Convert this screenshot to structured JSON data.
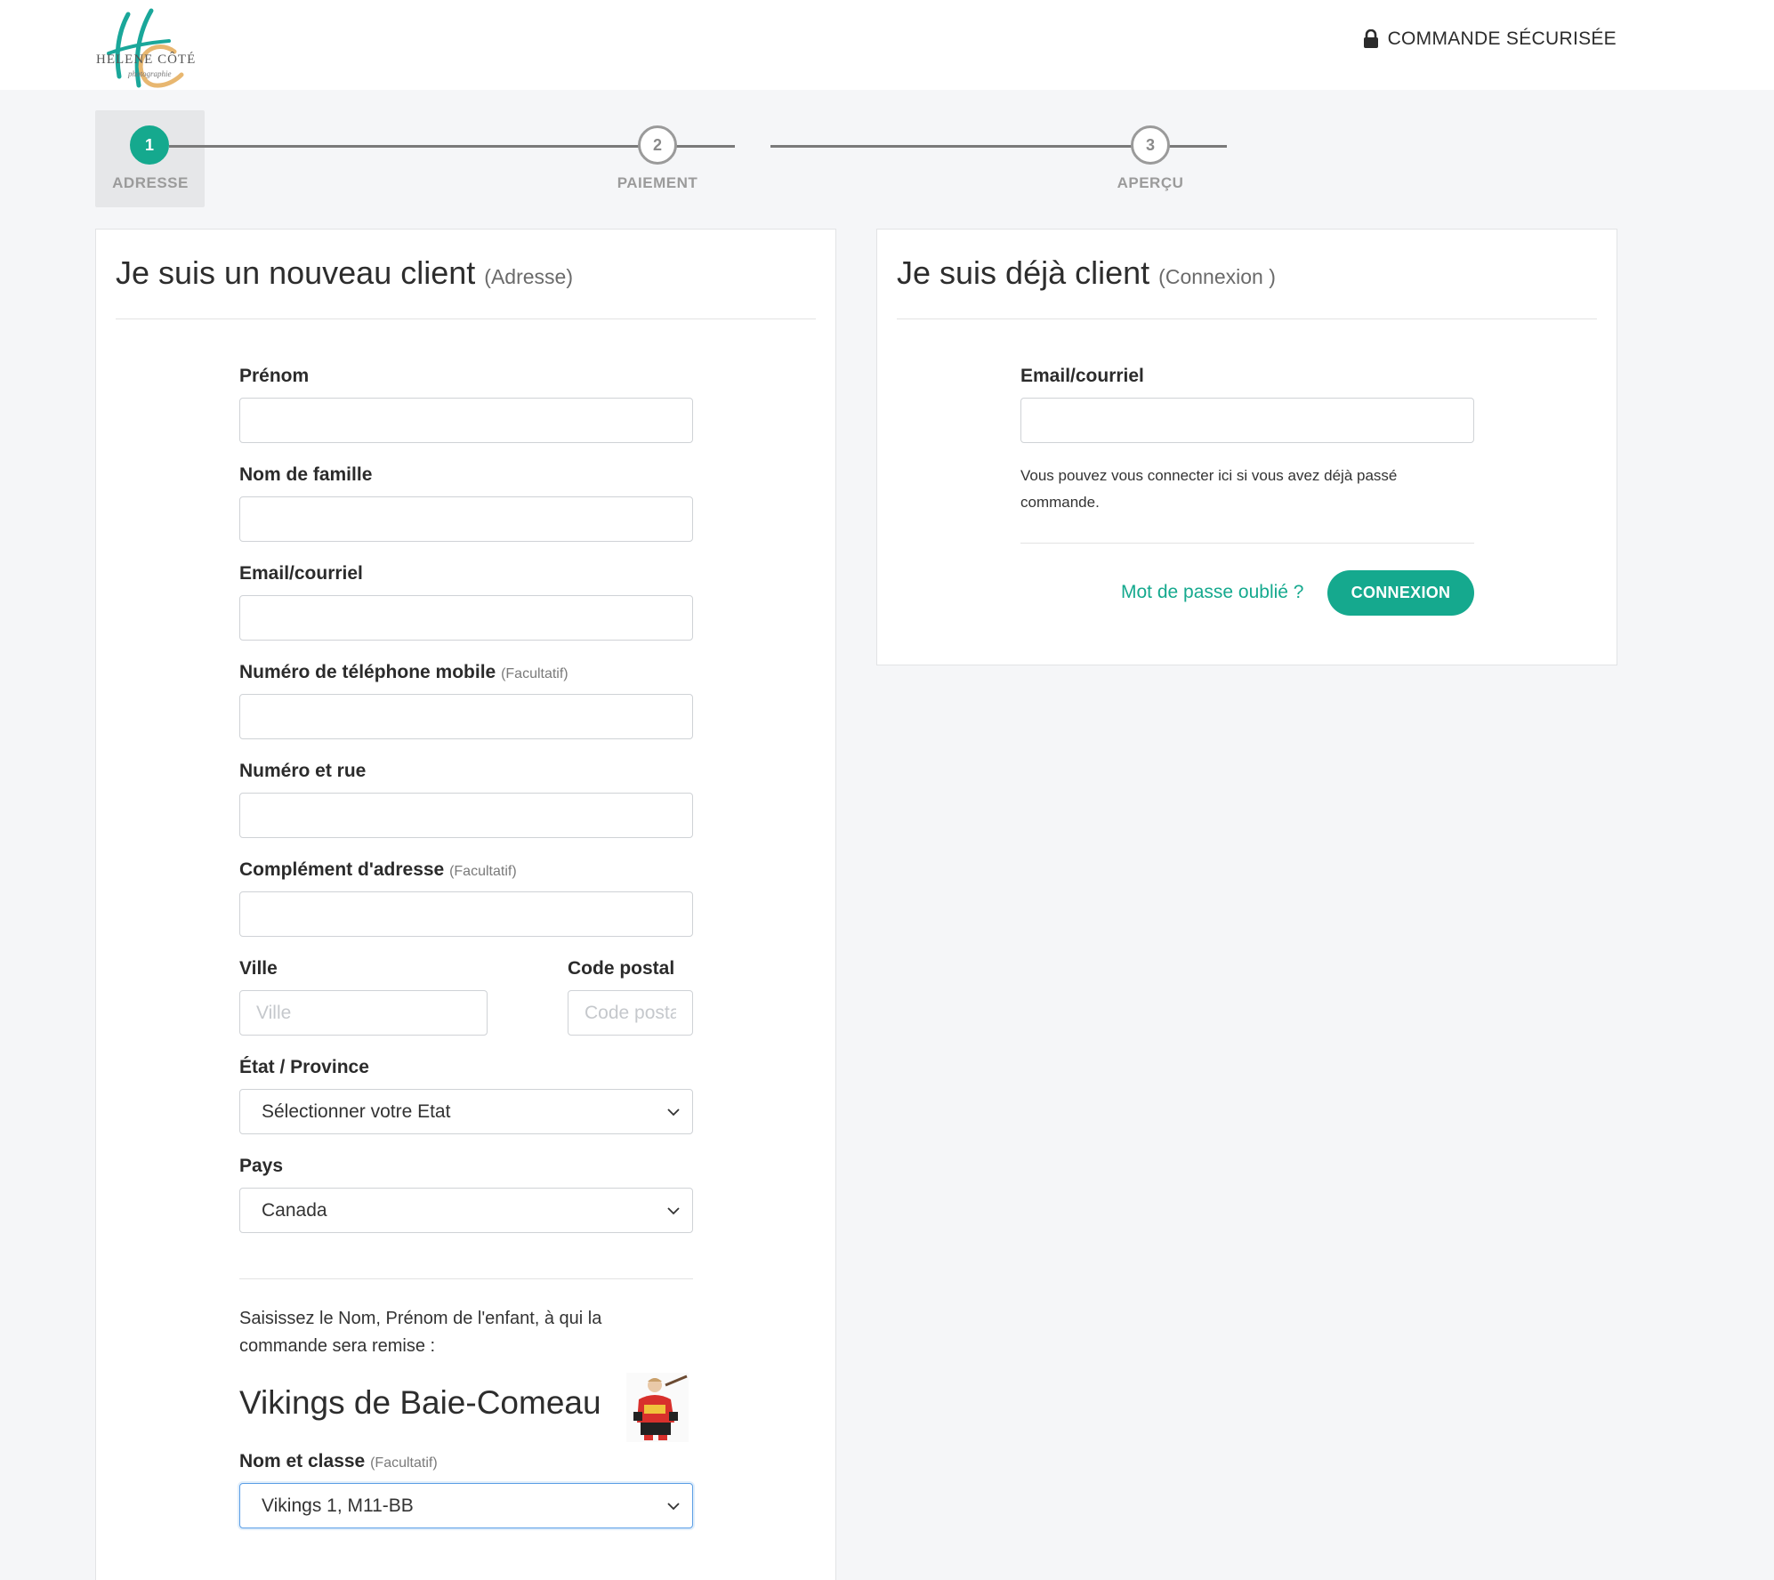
{
  "header": {
    "logo_text_main": "HELENE CÔTÉ",
    "logo_text_sub": "photographie",
    "secure_label": "COMMANDE SÉCURISÉE"
  },
  "stepper": {
    "steps": [
      {
        "number": "1",
        "label": "ADRESSE",
        "state": "active"
      },
      {
        "number": "2",
        "label": "PAIEMENT",
        "state": "todo"
      },
      {
        "number": "3",
        "label": "APERÇU",
        "state": "todo"
      }
    ]
  },
  "new_client": {
    "title": "Je suis un nouveau client",
    "title_sub": "(Adresse)",
    "fields": {
      "first_name": {
        "label": "Prénom",
        "value": "",
        "placeholder": ""
      },
      "last_name": {
        "label": "Nom de famille",
        "value": "",
        "placeholder": ""
      },
      "email": {
        "label": "Email/courriel",
        "value": "",
        "placeholder": ""
      },
      "phone": {
        "label": "Numéro de téléphone mobile",
        "optional": "(Facultatif)",
        "value": "",
        "placeholder": ""
      },
      "street": {
        "label": "Numéro et rue",
        "value": "",
        "placeholder": ""
      },
      "address2": {
        "label": "Complément d'adresse",
        "optional": "(Facultatif)",
        "value": "",
        "placeholder": ""
      },
      "city": {
        "label": "Ville",
        "value": "",
        "placeholder": "Ville"
      },
      "postal": {
        "label": "Code postal",
        "value": "",
        "placeholder": "Code postal"
      },
      "state": {
        "label": "État / Province",
        "selected": "Sélectionner votre Etat"
      },
      "country": {
        "label": "Pays",
        "selected": "Canada"
      }
    },
    "child_prompt": "Saisissez le Nom, Prénom de l'enfant, à qui la commande sera remise :",
    "team_name": "Vikings de Baie-Comeau",
    "class_field": {
      "label": "Nom et classe",
      "optional": "(Facultatif)",
      "selected": "Vikings 1, M11-BB"
    }
  },
  "existing_client": {
    "title": "Je suis déjà client",
    "title_sub": "(Connexion )",
    "email_label": "Email/courriel",
    "email_value": "",
    "help_text": "Vous pouvez vous connecter ici si vous avez déjà passé commande.",
    "forgot_label": "Mot de passe oublié ?",
    "login_button": "CONNEXION"
  },
  "colors": {
    "accent": "#15a98e",
    "background": "#f5f6f8",
    "focus": "#5b9ee6"
  },
  "icons": {
    "lock": "lock-icon",
    "chevron": "chevron-down-icon"
  }
}
